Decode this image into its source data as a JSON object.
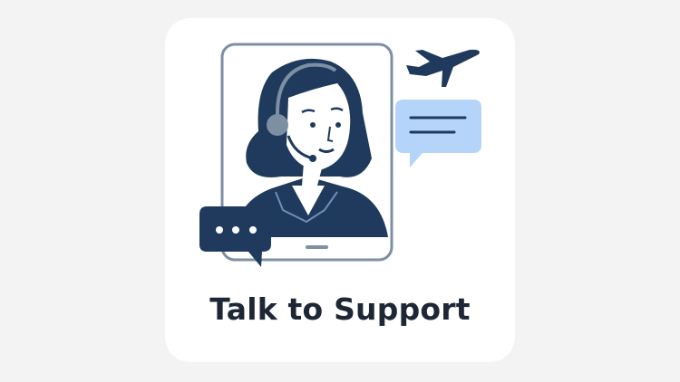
{
  "card": {
    "label": "Talk to Support",
    "icons": [
      "support-agent-headset",
      "airplane-icon",
      "chat-bubble-lines-icon",
      "chat-bubble-typing-icon"
    ],
    "colors": {
      "dark": "#1f3a5c",
      "frame": "#7d8fa3",
      "bubble_light": "#b4d4fa",
      "background": "#f3f3f3",
      "card": "#ffffff"
    }
  }
}
